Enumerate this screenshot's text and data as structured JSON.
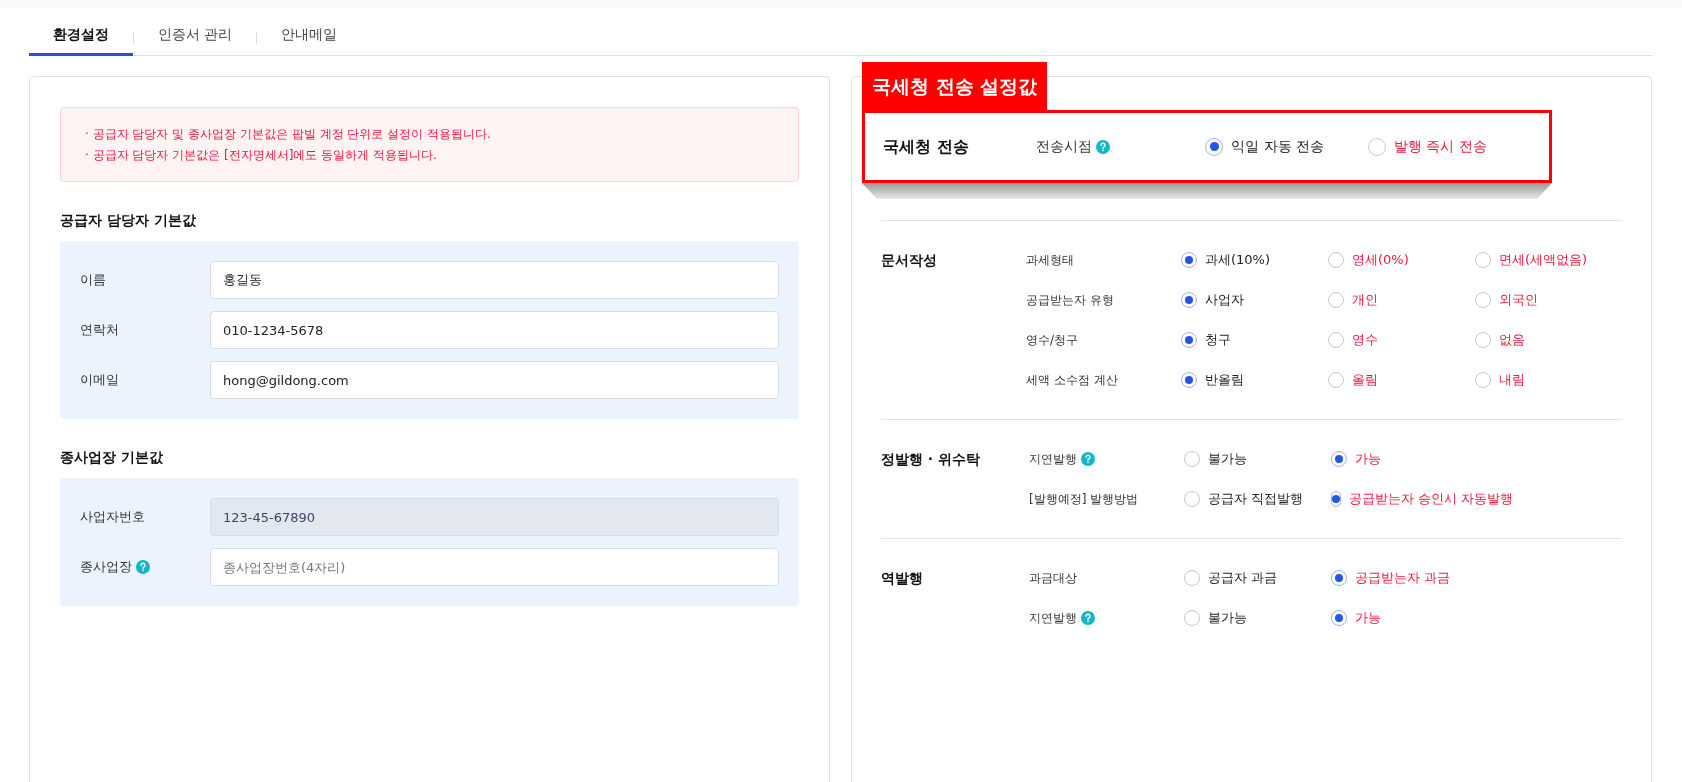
{
  "tabs": [
    {
      "label": "환경설정",
      "selected": true
    },
    {
      "label": "인증서 관리",
      "selected": false
    },
    {
      "label": "안내메일",
      "selected": false
    }
  ],
  "left_panel": {
    "notices": [
      "· 공급자 담당자 및 종사업장 기본값은 팝빌 계정 단위로 설정이 적용됩니다.",
      "· 공급자 담당자 기본값은 [전자명세서]에도 동일하게 적용됩니다."
    ],
    "sections": [
      {
        "title": "공급자 담당자 기본값",
        "fields": [
          {
            "label": "이름",
            "help": false,
            "value": "홍길동",
            "disabled": false
          },
          {
            "label": "연락처",
            "help": false,
            "value": "010-1234-5678",
            "disabled": false
          },
          {
            "label": "이메일",
            "help": false,
            "value": "hong@gildong.com",
            "disabled": false
          }
        ]
      },
      {
        "title": "종사업장 기본값",
        "fields": [
          {
            "label": "사업자번호",
            "help": false,
            "value": "123-45-67890",
            "disabled": true
          },
          {
            "label": "종사업장",
            "help": true,
            "placeholder": "종사업장번호(4자리)",
            "disabled": false
          }
        ]
      }
    ]
  },
  "callout": {
    "tag": "국세청 전송 설정값",
    "group": "국세청 전송",
    "setting": {
      "label": "전송시점",
      "help": true,
      "options": [
        {
          "label": "익일 자동 전송",
          "selected": true,
          "highlight": false
        },
        {
          "label": "발행 즉시 전송",
          "selected": false,
          "highlight": true
        }
      ]
    }
  },
  "groups": [
    {
      "title": "문서작성",
      "settings": [
        {
          "label": "과세형태",
          "help": false,
          "options": [
            {
              "label": "과세(10%)",
              "selected": true,
              "highlight": false
            },
            {
              "label": "영세(0%)",
              "selected": false,
              "highlight": true
            },
            {
              "label": "면세(세액없음)",
              "selected": false,
              "highlight": true
            }
          ]
        },
        {
          "label": "공급받는자 유형",
          "help": false,
          "options": [
            {
              "label": "사업자",
              "selected": true,
              "highlight": false
            },
            {
              "label": "개인",
              "selected": false,
              "highlight": true
            },
            {
              "label": "외국인",
              "selected": false,
              "highlight": true
            }
          ]
        },
        {
          "label": "영수/청구",
          "help": false,
          "options": [
            {
              "label": "청구",
              "selected": true,
              "highlight": false
            },
            {
              "label": "영수",
              "selected": false,
              "highlight": true
            },
            {
              "label": "없음",
              "selected": false,
              "highlight": true
            }
          ]
        },
        {
          "label": "세액 소수점 계산",
          "help": false,
          "options": [
            {
              "label": "반올림",
              "selected": true,
              "highlight": false
            },
            {
              "label": "올림",
              "selected": false,
              "highlight": true
            },
            {
              "label": "내림",
              "selected": false,
              "highlight": true
            }
          ]
        }
      ]
    },
    {
      "title": "정발행 · 위수탁",
      "settings": [
        {
          "label": "지연발행",
          "help": true,
          "options": [
            {
              "label": "불가능",
              "selected": false,
              "highlight": false
            },
            {
              "label": "가능",
              "selected": true,
              "highlight": true
            }
          ]
        },
        {
          "label": "[발행예정] 발행방법",
          "help": false,
          "options": [
            {
              "label": "공급자 직접발행",
              "selected": false,
              "highlight": false
            },
            {
              "label": "공급받는자 승인시 자동발행",
              "selected": true,
              "highlight": true
            }
          ]
        }
      ]
    },
    {
      "title": "역발행",
      "settings": [
        {
          "label": "과금대상",
          "help": false,
          "options": [
            {
              "label": "공급자 과금",
              "selected": false,
              "highlight": false
            },
            {
              "label": "공급받는자 과금",
              "selected": true,
              "highlight": true
            }
          ]
        },
        {
          "label": "지연발행",
          "help": true,
          "options": [
            {
              "label": "불가능",
              "selected": false,
              "highlight": false
            },
            {
              "label": "가능",
              "selected": true,
              "highlight": true
            }
          ]
        }
      ]
    }
  ]
}
